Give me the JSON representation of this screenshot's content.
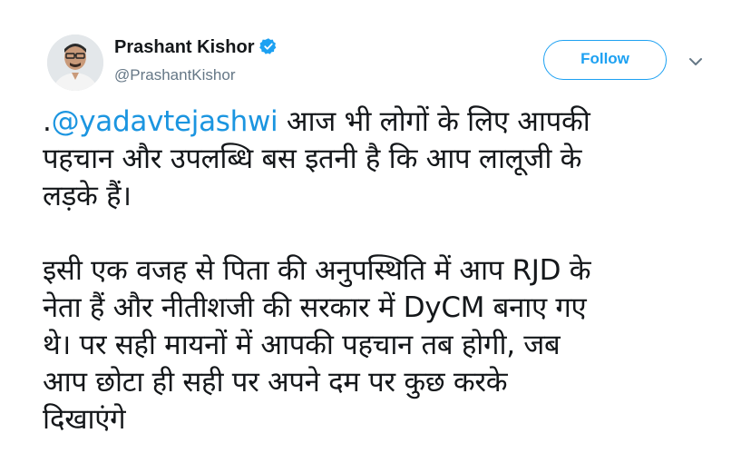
{
  "author": {
    "display_name": "Prashant Kishor",
    "handle": "@PrashantKishor",
    "verified": true
  },
  "actions": {
    "follow_label": "Follow"
  },
  "tweet": {
    "mention": "@yadavtejashwi",
    "lines": [
      ".",
      " आज भी लोगों के लिए आपकी",
      "पहचान और उपलब्धि बस इतनी है कि आप लालूजी के",
      "लड़के हैं।",
      "इसी एक वजह से पिता की अनुपस्थिति में आप RJD के",
      "नेता हैं और नीतीशजी की सरकार में DyCM बनाए गए",
      "थे। पर सही मायनों में आपकी पहचान तब होगी, जब",
      "आप छोटा ही सही पर अपने दम पर कुछ करके",
      "दिखाएंगे"
    ]
  },
  "colors": {
    "link": "#1b95e0",
    "follow": "#1da1f2",
    "secondary_text": "#657786",
    "primary_text": "#14171a"
  },
  "icons": {
    "verified": "verified-badge-icon",
    "caret": "chevron-down-icon"
  }
}
